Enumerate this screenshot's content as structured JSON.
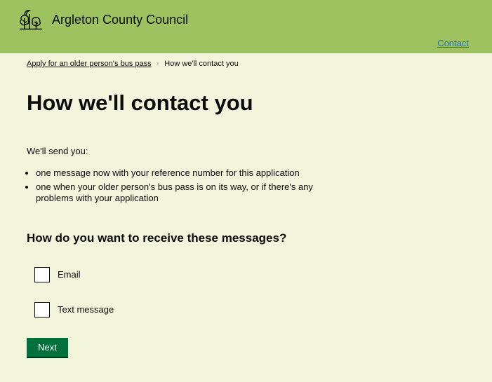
{
  "header": {
    "org_name": "Argleton County Council",
    "logo_icon": "trees-logo-icon",
    "contact_link": "Contact",
    "background_color": "#9dc25f"
  },
  "breadcrumb": {
    "parent": "Apply for an older person's bus pass",
    "current": "How we'll contact you"
  },
  "main": {
    "title": "How we'll contact you",
    "intro": "We'll send you:",
    "bullets": [
      "one message now with your reference number for this application",
      "one when your older person's bus pass is on its way, or if there's any problems with your application"
    ],
    "question": "How do you want to receive these messages?",
    "options": [
      {
        "label": "Email",
        "checked": false
      },
      {
        "label": "Text message",
        "checked": false
      }
    ],
    "next_button": "Next",
    "button_color": "#00703c",
    "page_background": "#f3f4dc"
  }
}
